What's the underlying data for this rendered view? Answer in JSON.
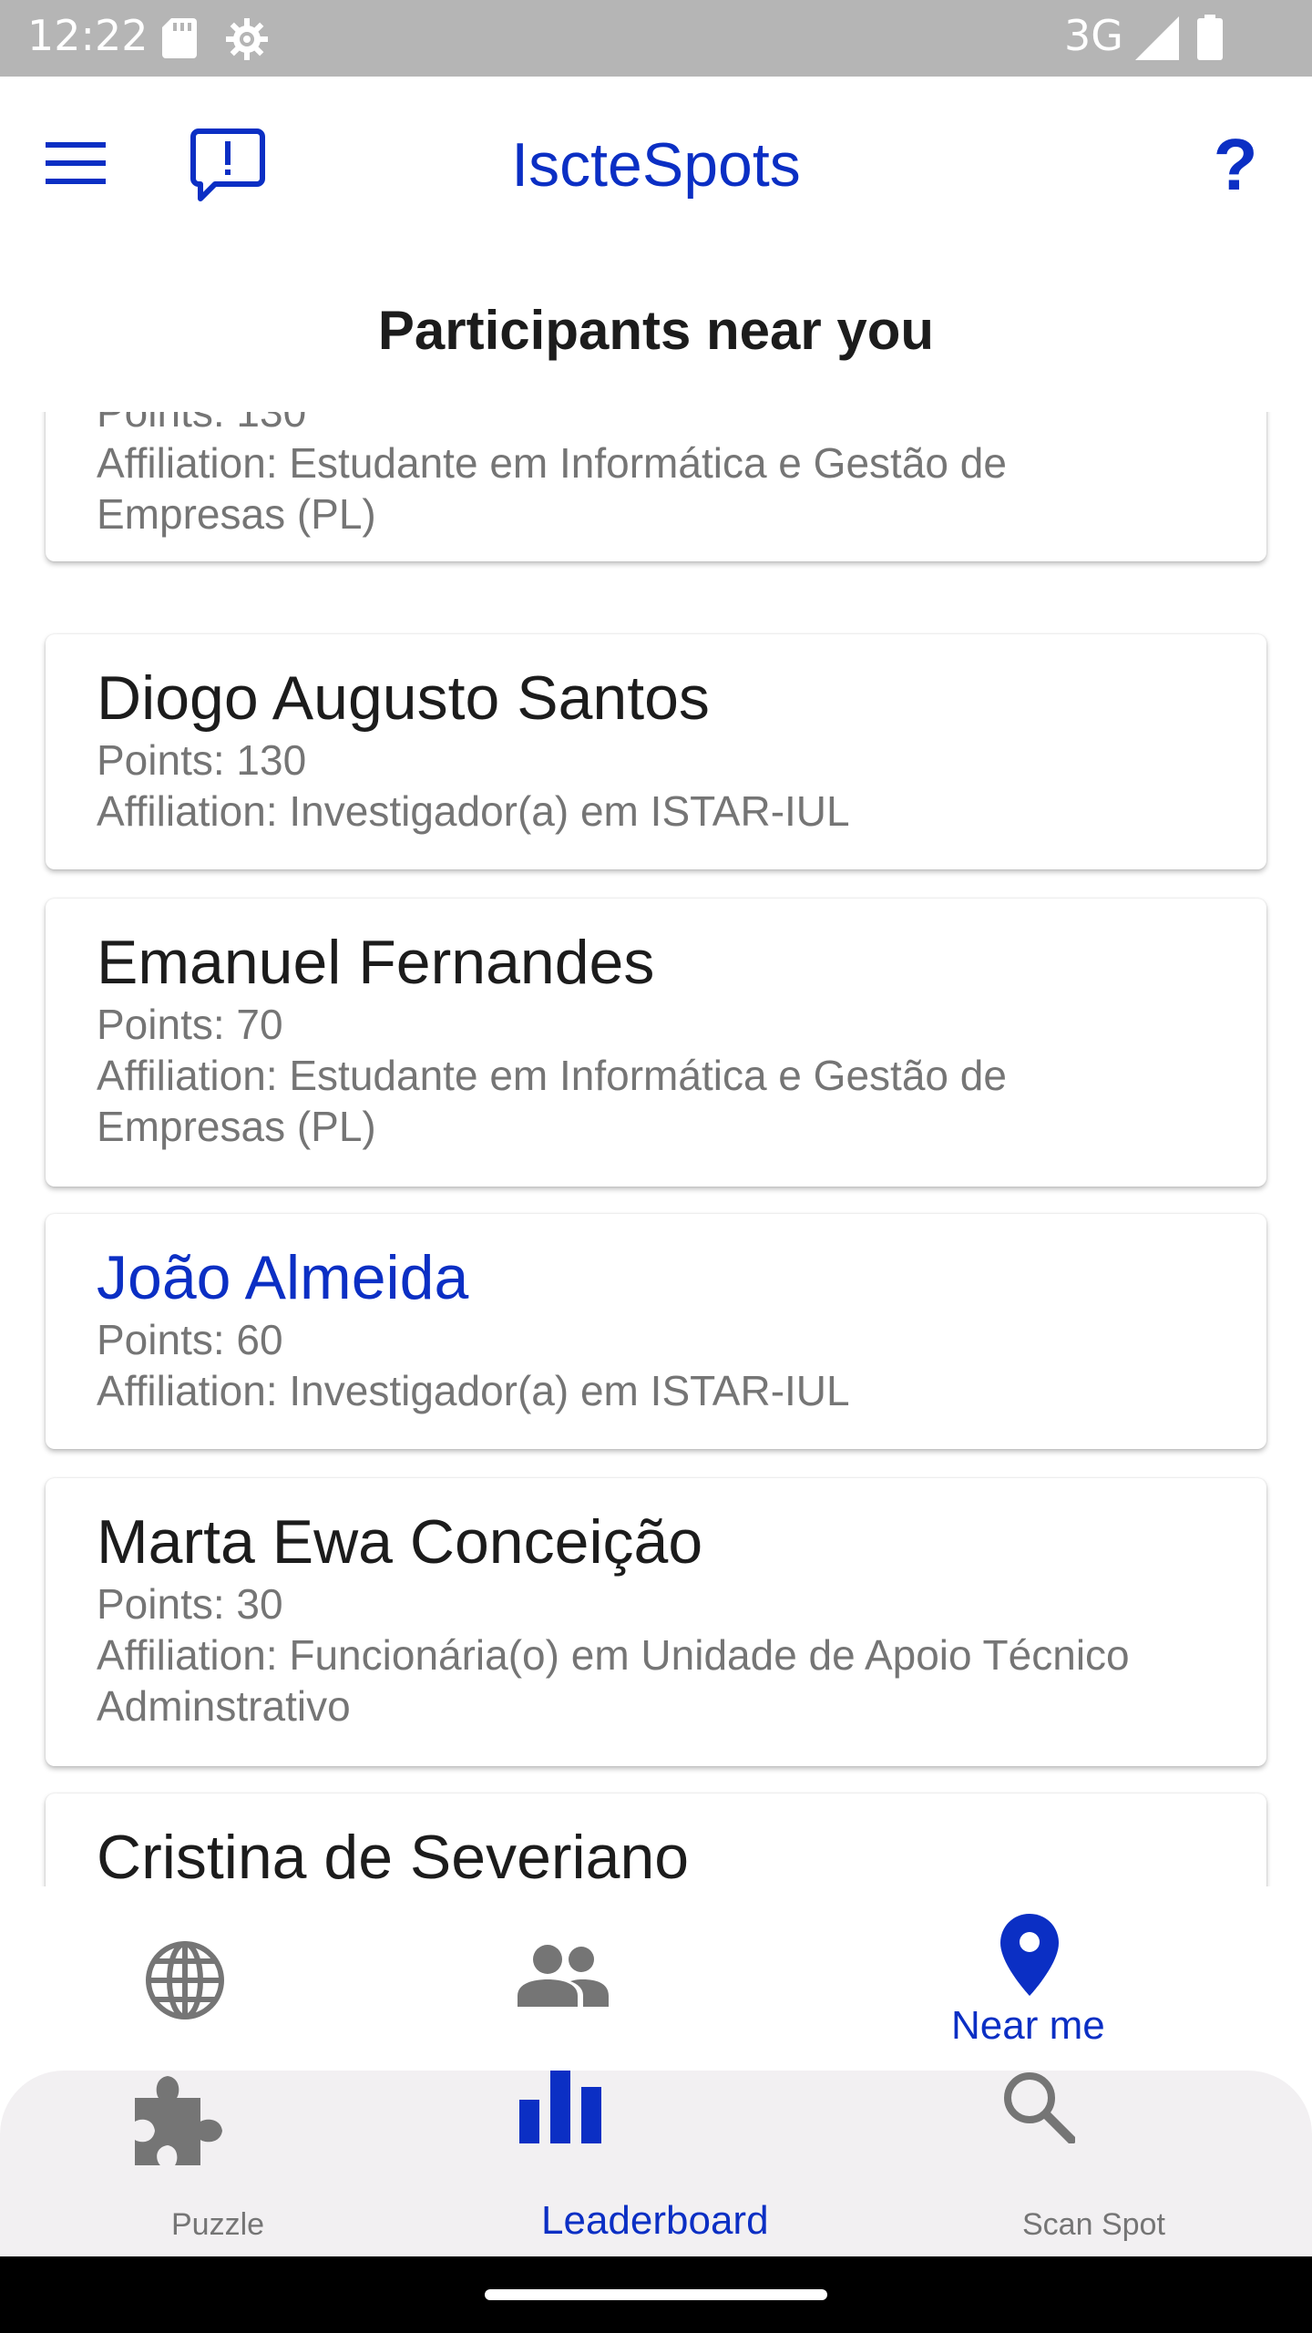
{
  "status_bar": {
    "time": "12:22",
    "network": "3G"
  },
  "app_bar": {
    "title": "IscteSpots",
    "help_label": "?"
  },
  "page_heading": "Participants near you",
  "participants": [
    {
      "name": "",
      "points": "Points: 130",
      "affiliation_line1": "Affiliation: Estudante em Informática e Gestão de",
      "affiliation_line2": "Empresas (PL)"
    },
    {
      "name": "Diogo Augusto Santos",
      "points": "Points: 130",
      "affiliation_line1": "Affiliation: Investigador(a) em ISTAR-IUL",
      "affiliation_line2": ""
    },
    {
      "name": "Emanuel Fernandes",
      "points": "Points: 70",
      "affiliation_line1": "Affiliation: Estudante em Informática e Gestão de",
      "affiliation_line2": "Empresas (PL)"
    },
    {
      "name": "João Almeida",
      "points": "Points: 60",
      "affiliation_line1": "Affiliation: Investigador(a) em ISTAR-IUL",
      "affiliation_line2": ""
    },
    {
      "name": "Marta Ewa Conceição",
      "points": "Points: 30",
      "affiliation_line1": "Affiliation: Funcionária(o) em Unidade de Apoio Técnico",
      "affiliation_line2": "Adminstrativo"
    },
    {
      "name": "Cristina de Severiano",
      "points": "",
      "affiliation_line1": "",
      "affiliation_line2": ""
    }
  ],
  "subtabs": {
    "global_icon": "globe-icon",
    "affiliation_icon": "people-icon",
    "near_me_icon": "location-pin-icon",
    "near_me_label": "Near me"
  },
  "bottom_nav": {
    "puzzle_label": "Puzzle",
    "leaderboard_label": "Leaderboard",
    "scan_label": "Scan Spot"
  },
  "colors": {
    "accent": "#0b2fc4",
    "inactive": "#757575",
    "status_bar": "#b5b5b5"
  }
}
